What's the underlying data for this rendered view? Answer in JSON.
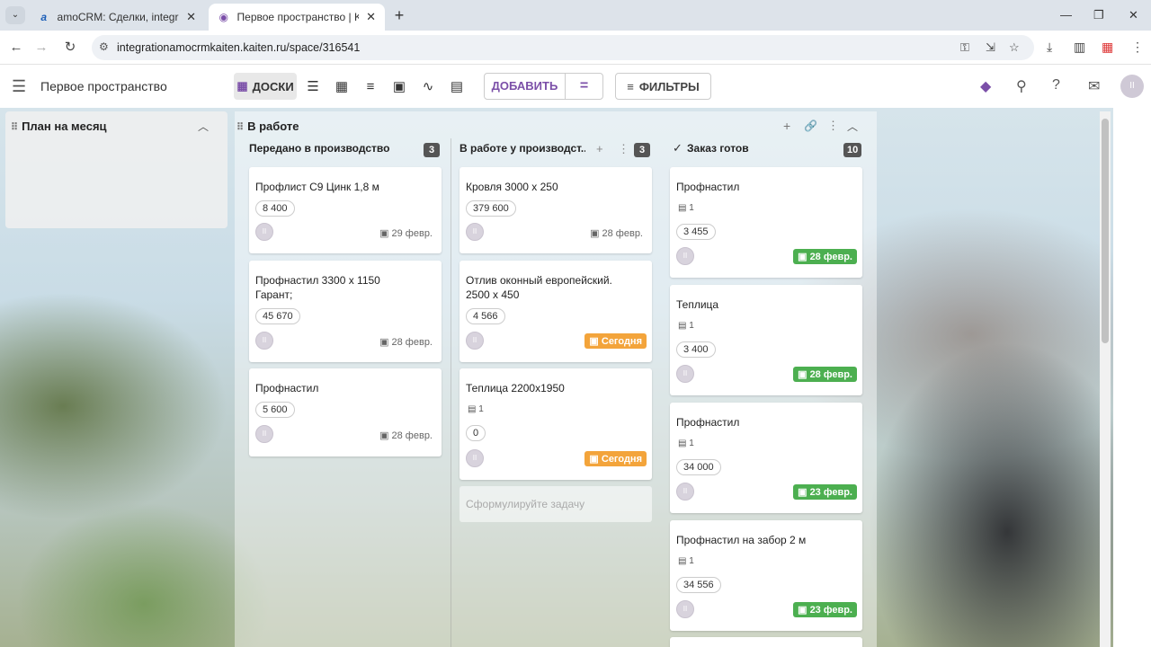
{
  "browser": {
    "tabs": [
      {
        "title": "amoCRM: Сделки, integrationa",
        "icon": "amocrm-favicon"
      },
      {
        "title": "Первое пространство | Kaiten",
        "icon": "kaiten-favicon"
      }
    ],
    "url": "integrationamocrmkaiten.kaiten.ru/space/316541"
  },
  "app": {
    "space_title": "Первое пространство",
    "view_active": "ДОСКИ",
    "add_label": "ДОБАВИТЬ",
    "filter_label": "ФИЛЬТРЫ"
  },
  "board": {
    "plan_column": {
      "title": "План на месяц"
    },
    "work_column": {
      "title": "В работе"
    },
    "subcolumns": [
      {
        "title": "Передано в производство",
        "count": "3",
        "cards": [
          {
            "title": "Профлист С9 Цинк 1,8 м",
            "price": "8 400",
            "date": "29 февр."
          },
          {
            "title": "Профнастил 3300 х 1150 Гарант;",
            "price": "45 670",
            "date": "28 февр."
          },
          {
            "title": "Профнастил",
            "price": "5 600",
            "date": "28 февр."
          }
        ]
      },
      {
        "title": "В работе у производст...",
        "count": "3",
        "cards": [
          {
            "title": "Кровля 3000 х 250",
            "price": "379 600",
            "date": "28 февр."
          },
          {
            "title": "Отлив оконный европейский. 2500 х 450",
            "price": "4 566",
            "date": "Сегодня"
          },
          {
            "title": "Теплица 2200х1950",
            "comments": "1",
            "price": "0",
            "date": "Сегодня"
          }
        ],
        "placeholder": "Сформулируйте задачу"
      },
      {
        "title": "Заказ готов",
        "count": "10",
        "cards": [
          {
            "title": "Профнастил",
            "comments": "1",
            "price": "3 455",
            "date": "28 февр."
          },
          {
            "title": "Теплица",
            "comments": "1",
            "price": "3 400",
            "date": "28 февр."
          },
          {
            "title": "Профнастил",
            "comments": "1",
            "price": "34 000",
            "date": "23 февр."
          },
          {
            "title": "Профнастил на забор 2 м",
            "comments": "1",
            "price": "34 556",
            "date": "23 февр."
          }
        ]
      }
    ]
  },
  "colors": {
    "accent": "#7b4fa8",
    "today": "#f3a43b",
    "done": "#4caf50"
  }
}
